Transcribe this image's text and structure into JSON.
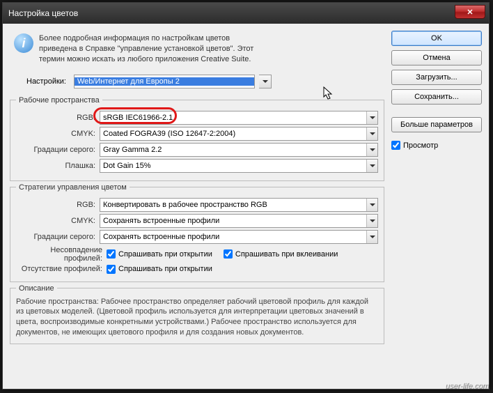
{
  "window": {
    "title": "Настройка цветов",
    "close_glyph": "✕"
  },
  "info": {
    "icon_glyph": "i",
    "line1": "Более подробная информация по настройкам цветов",
    "line2": "приведена в Справке \"управление установкой цветов\". Этот",
    "line3": "термин можно искать из любого приложения Creative Suite."
  },
  "settings": {
    "label": "Настройки:",
    "value": "Web/Интернет для Европы 2"
  },
  "workspaces": {
    "legend": "Рабочие пространства",
    "rgb_label": "RGB:",
    "rgb_value": "sRGB IEC61966-2.1",
    "cmyk_label": "CMYK:",
    "cmyk_value": "Coated FOGRA39 (ISO 12647-2:2004)",
    "gray_label": "Градации серого:",
    "gray_value": "Gray Gamma 2.2",
    "spot_label": "Плашка:",
    "spot_value": "Dot Gain 15%"
  },
  "policies": {
    "legend": "Стратегии управления цветом",
    "rgb_label": "RGB:",
    "rgb_value": "Конвертировать в рабочее пространство RGB",
    "cmyk_label": "CMYK:",
    "cmyk_value": "Сохранять встроенные профили",
    "gray_label": "Градации серого:",
    "gray_value": "Сохранять встроенные профили",
    "mismatch_label": "Несовпадение профилей:",
    "mismatch_open": "Спрашивать при открытии",
    "mismatch_paste": "Спрашивать при вклеивании",
    "missing_label": "Отсутствие профилей:",
    "missing_open": "Спрашивать при открытии"
  },
  "description": {
    "legend": "Описание",
    "text": "Рабочие пространства:  Рабочее пространство определяет рабочий цветовой профиль для каждой из цветовых моделей.  (Цветовой профиль используется для интерпретации цветовых значений в цвета, воспроизводимые конкретными устройствами.)  Рабочее пространство используется для документов, не имеющих цветового профиля и для создания новых документов."
  },
  "buttons": {
    "ok": "OK",
    "cancel": "Отмена",
    "load": "Загрузить...",
    "save": "Сохранить...",
    "more": "Больше параметров",
    "preview": "Просмотр"
  },
  "watermark": "user-life.com"
}
